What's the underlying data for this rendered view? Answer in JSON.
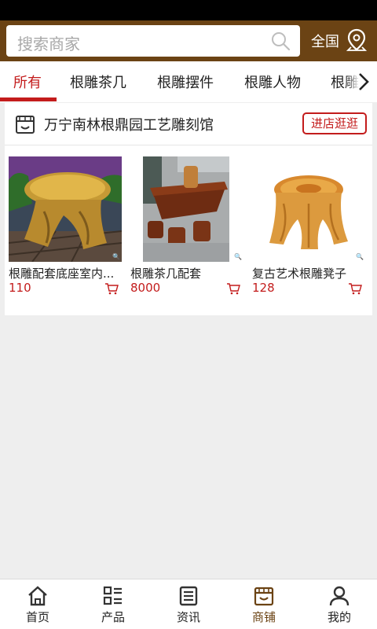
{
  "search": {
    "placeholder": "搜索商家"
  },
  "header": {
    "region_label": "全国"
  },
  "tabs": [
    {
      "label": "所有",
      "active": true
    },
    {
      "label": "根雕茶几"
    },
    {
      "label": "根雕摆件"
    },
    {
      "label": "根雕人物"
    },
    {
      "label": "根雕"
    }
  ],
  "shop": {
    "name": "万宁南林根鼎园工艺雕刻馆",
    "visit_label": "进店逛逛",
    "products": [
      {
        "name": "根雕配套底座室内...",
        "price": "110"
      },
      {
        "name": "根雕茶几配套",
        "price": "8000"
      },
      {
        "name": "复古艺术根雕凳子",
        "price": "128"
      }
    ]
  },
  "bottom_nav": [
    {
      "label": "首页",
      "icon": "home-icon"
    },
    {
      "label": "产品",
      "icon": "grid-list-icon"
    },
    {
      "label": "资讯",
      "icon": "news-icon"
    },
    {
      "label": "商铺",
      "icon": "shop-icon",
      "active": true
    },
    {
      "label": "我的",
      "icon": "user-icon"
    }
  ],
  "colors": {
    "header_bg": "#6b4314",
    "accent_red": "#c31c1c",
    "active_nav": "#6b4314"
  }
}
